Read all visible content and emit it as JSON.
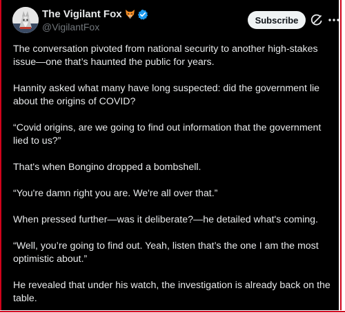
{
  "author": {
    "display_name": "The Vigilant Fox",
    "name_emoji": "fox-face-emoji",
    "verified_icon": "verified-badge-icon",
    "handle": "@VigilantFox"
  },
  "actions": {
    "subscribe_label": "Subscribe",
    "grok_icon": "grok-icon",
    "more_icon": "more-options-icon"
  },
  "tweet": {
    "paragraphs": [
      "The conversation pivoted from national security to another high-stakes issue—one that’s haunted the public for years.",
      "Hannity asked what many have long suspected: did the government lie about the origins of COVID?",
      "“Covid origins, are we going to find out information that the government lied to us?”",
      "That's when Bongino dropped a bombshell.",
      "“You're damn right you are. We're all over that.”",
      "When pressed further—was it deliberate?—he detailed what's coming.",
      "“Well, you’re going to find out. Yeah, listen that’s the one I am the most optimistic about.”",
      "He revealed that under his watch, the investigation is already back on the table."
    ]
  },
  "colors": {
    "background": "#000000",
    "text": "#e7e9ea",
    "secondary_text": "#71767b",
    "subscribe_bg": "#eff3f4",
    "verified_blue": "#1d9bf0",
    "frame_red": "#d0021b"
  }
}
